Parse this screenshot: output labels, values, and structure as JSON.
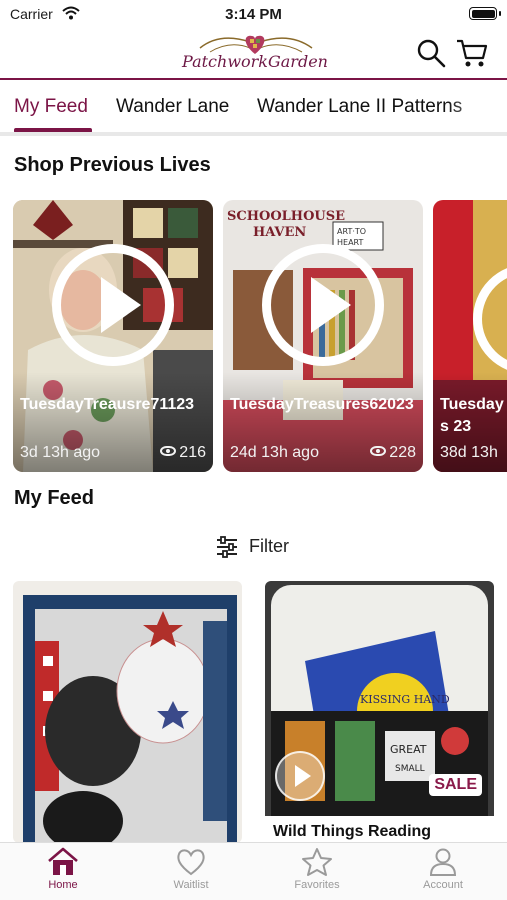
{
  "status_bar": {
    "carrier": "Carrier",
    "time": "3:14 PM"
  },
  "header": {
    "logo_text": "PatchworkGarden"
  },
  "tabs": [
    {
      "label": "My Feed",
      "active": true
    },
    {
      "label": "Wander Lane",
      "active": false
    },
    {
      "label": "Wander Lane II Patterns",
      "active": false
    }
  ],
  "sections": {
    "previous_lives": "Shop Previous Lives",
    "my_feed": "My Feed"
  },
  "lives": [
    {
      "title": "TuesdayTreausre71123",
      "age": "3d 13h ago",
      "views": "216"
    },
    {
      "title": "TuesdayTreasures62023",
      "age": "24d 13h ago",
      "views": "228"
    },
    {
      "title": "Tuesdays 23",
      "age": "38d 13h",
      "views": ""
    }
  ],
  "filter": {
    "label": "Filter"
  },
  "feed": [
    {
      "caption": "",
      "badge": ""
    },
    {
      "caption": "Wild Things Reading",
      "badge": "SALE"
    }
  ],
  "bottom_nav": [
    {
      "label": "Home",
      "icon": "home-icon",
      "active": true
    },
    {
      "label": "Waitlist",
      "icon": "heart-icon",
      "active": false
    },
    {
      "label": "Favorites",
      "icon": "star-icon",
      "active": false
    },
    {
      "label": "Account",
      "icon": "person-icon",
      "active": false
    }
  ],
  "colors": {
    "accent": "#7b1446",
    "text": "#111111",
    "muted": "#9a9a9a"
  }
}
